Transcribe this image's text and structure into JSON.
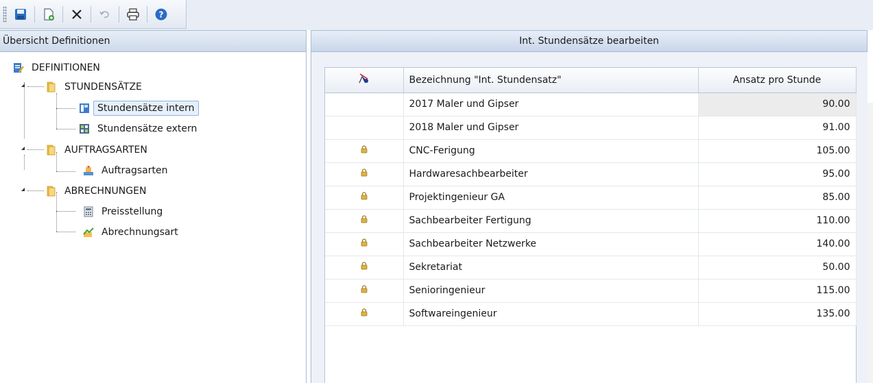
{
  "toolbar": {
    "buttons": [
      {
        "name": "save-button",
        "icon": "save-icon"
      },
      {
        "name": "new-button",
        "icon": "new-document-icon"
      },
      {
        "name": "delete-button",
        "icon": "delete-x-icon"
      },
      {
        "name": "undo-button",
        "icon": "undo-icon"
      },
      {
        "name": "print-button",
        "icon": "printer-icon"
      },
      {
        "name": "help-button",
        "icon": "help-icon"
      }
    ]
  },
  "left_panel": {
    "title": "Übersicht Definitionen",
    "tree": {
      "root": "DEFINITIONEN",
      "group1": {
        "label": "STUNDENSÄTZE",
        "items": [
          "Stundensätze intern",
          "Stundensätze extern"
        ]
      },
      "group2": {
        "label": "AUFTRAGSARTEN",
        "items": [
          "Auftragsarten"
        ]
      },
      "group3": {
        "label": "ABRECHNUNGEN",
        "items": [
          "Preisstellung",
          "Abrechnungsart"
        ]
      },
      "selected": "Stundensätze intern"
    }
  },
  "right_panel": {
    "title": "Int. Stundensätze bearbeiten",
    "table": {
      "columns": [
        "",
        "Bezeichnung \"Int. Stundensatz\"",
        "Ansatz pro Stunde"
      ],
      "header_icon": "pin-remove-icon",
      "rows": [
        {
          "locked": false,
          "bezeichnung": "2017 Maler und Gipser",
          "ansatz": "90.00"
        },
        {
          "locked": false,
          "bezeichnung": "2018 Maler und Gipser",
          "ansatz": "91.00"
        },
        {
          "locked": true,
          "bezeichnung": "CNC-Ferigung",
          "ansatz": "105.00"
        },
        {
          "locked": true,
          "bezeichnung": "Hardwaresachbearbeiter",
          "ansatz": "95.00"
        },
        {
          "locked": true,
          "bezeichnung": "Projektingenieur GA",
          "ansatz": "85.00"
        },
        {
          "locked": true,
          "bezeichnung": "Sachbearbeiter Fertigung",
          "ansatz": "110.00"
        },
        {
          "locked": true,
          "bezeichnung": "Sachbearbeiter Netzwerke",
          "ansatz": "140.00"
        },
        {
          "locked": true,
          "bezeichnung": "Sekretariat",
          "ansatz": "50.00"
        },
        {
          "locked": true,
          "bezeichnung": "Senioringenieur",
          "ansatz": "115.00"
        },
        {
          "locked": true,
          "bezeichnung": "Softwareingenieur",
          "ansatz": "135.00"
        }
      ]
    }
  },
  "colors": {
    "accent": "#2e6fc0",
    "folder": "#f2c14e",
    "lock": "#d4a017",
    "header_bg": "#d6e1f0"
  }
}
